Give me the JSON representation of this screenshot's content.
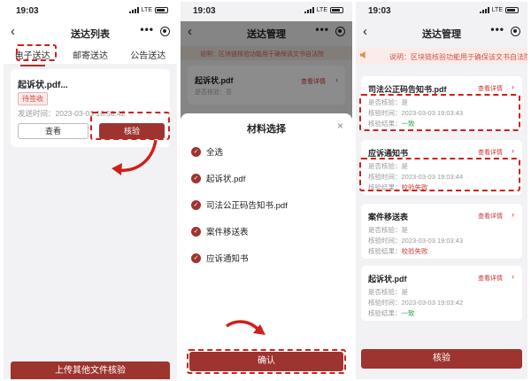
{
  "status": {
    "time": "19:03",
    "network": "LTE"
  },
  "icons": {
    "back": "chevron-left-icon",
    "more": "more-dots-icon",
    "target": "target-circle-icon",
    "close": "close-icon",
    "check": "check-circle-icon",
    "speaker": "speaker-icon",
    "arrow": "chevron-right-icon"
  },
  "colors": {
    "primary": "#9e342f",
    "annotation": "#d0201c",
    "success": "#2fa34a",
    "failure": "#d23b2f"
  },
  "phone1": {
    "title": "送达列表",
    "tabs": [
      {
        "label": "电子送达",
        "active": true
      },
      {
        "label": "邮寄送达"
      },
      {
        "label": "公告送达"
      }
    ],
    "card": {
      "title": "起诉状.pdf...",
      "badge": "待签收",
      "send_time": "发送时间：2023-03-03 18:58:42",
      "view_label": "查看",
      "verify_label": "核验"
    },
    "upload_label": "上传其他文件核验"
  },
  "phone2": {
    "title": "送达管理",
    "bg_notice": "说明：区块链核验功能用于确保该文书自法院",
    "bg_card_title": "起诉状.pdf",
    "bg_card_sub": "是否核验：否",
    "bg_card_link": "查看详情",
    "sheet_title": "材料选择",
    "options": [
      "全选",
      "起诉状.pdf",
      "司法公正码告知书.pdf",
      "案件移送表",
      "应诉通知书"
    ],
    "confirm_label": "确认"
  },
  "phone3": {
    "title": "送达管理",
    "notice": "说明：区块链核验功能用于确保该文书自法院",
    "detail_label": "查看详情",
    "cards": [
      {
        "title": "司法公正码告知书.pdf",
        "verified": "是否核验：是",
        "time": "核验时间：2023-03-03 19:03:43",
        "result_label": "核验结果：",
        "result": "一致",
        "status": "ok"
      },
      {
        "title": "应诉通知书",
        "verified": "是否核验：是",
        "time": "核验时间：2023-03-03 19:03:44",
        "result_label": "核验结果：",
        "result": "校验失败",
        "status": "fail"
      },
      {
        "title": "案件移送表",
        "verified": "是否核验：是",
        "time": "核验时间：2023-03-03 19:03:43",
        "result_label": "核验结果：",
        "result": "校验失败",
        "status": "fail"
      },
      {
        "title": "起诉状.pdf",
        "verified": "是否核验：是",
        "time": "核验时间：2023-03-03 19:03:42",
        "result_label": "核验结果：",
        "result": "一致",
        "status": "ok"
      }
    ],
    "verify_label": "核验"
  }
}
